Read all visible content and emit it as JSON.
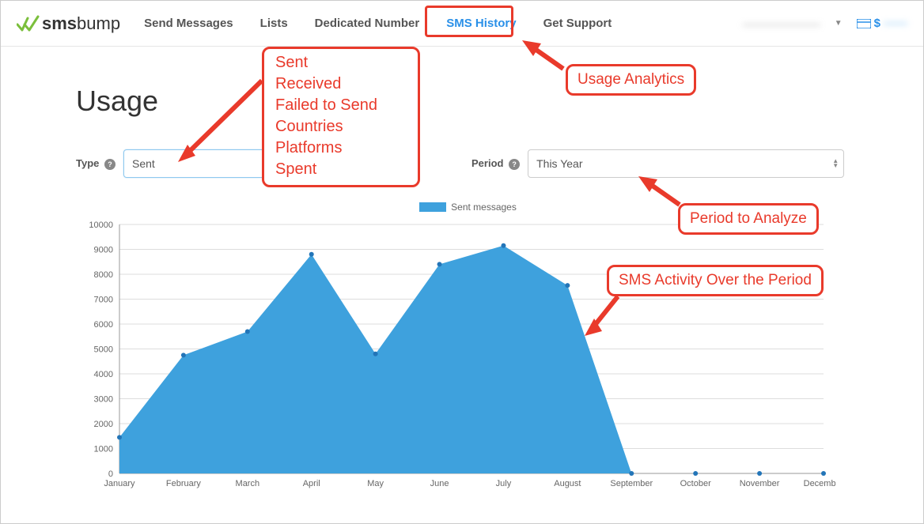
{
  "brand": {
    "sms": "sms",
    "bump": "bump"
  },
  "nav": {
    "items": [
      "Send Messages",
      "Lists",
      "Dedicated Number",
      "SMS History",
      "Get Support"
    ],
    "active_index": 3
  },
  "user": {
    "name_obscured": "———————",
    "balance_prefix": "$",
    "balance_obscured": "——"
  },
  "page": {
    "title": "Usage"
  },
  "filters": {
    "type_label": "Type",
    "type_value": "Sent",
    "period_label": "Period",
    "period_value": "This Year"
  },
  "legend": {
    "label": "Sent messages"
  },
  "annotations": {
    "type_options": [
      "Sent",
      "Received",
      "Failed to Send",
      "Countries",
      "Platforms",
      "Spent"
    ],
    "usage_analytics": "Usage Analytics",
    "period_to_analyze": "Period to Analyze",
    "sms_activity": "SMS Activity Over the Period"
  },
  "chart_data": {
    "type": "area",
    "title": "",
    "xlabel": "",
    "ylabel": "",
    "ylim": [
      0,
      10000
    ],
    "yticks": [
      0,
      1000,
      2000,
      3000,
      4000,
      5000,
      6000,
      7000,
      8000,
      9000,
      10000
    ],
    "categories": [
      "January",
      "February",
      "March",
      "April",
      "May",
      "June",
      "July",
      "August",
      "September",
      "October",
      "November",
      "December"
    ],
    "series": [
      {
        "name": "Sent messages",
        "values": [
          1450,
          4750,
          5700,
          8800,
          4800,
          8400,
          9150,
          7550,
          0,
          0,
          0,
          0
        ]
      }
    ],
    "legend_position": "top-center",
    "grid": true
  }
}
